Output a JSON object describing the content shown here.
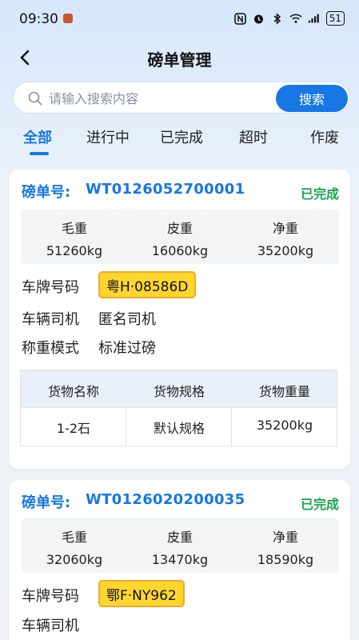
{
  "status_bar": {
    "time": "09:30",
    "battery": "51",
    "icons": [
      "nfc-icon",
      "alarm-icon",
      "bluetooth-icon",
      "wifi-icon",
      "signal-icon",
      "battery-icon"
    ]
  },
  "header": {
    "title": "磅单管理"
  },
  "search": {
    "placeholder": "请输入搜索内容",
    "value": "",
    "button_label": "搜索"
  },
  "tabs": [
    {
      "label": "全部",
      "active": true
    },
    {
      "label": "进行中",
      "active": false
    },
    {
      "label": "已完成",
      "active": false
    },
    {
      "label": "超时",
      "active": false
    },
    {
      "label": "作废",
      "active": false
    }
  ],
  "colors": {
    "accent": "#1677e5",
    "success": "#18a54a",
    "plate_bg": "#ffd62e",
    "plate_border": "#f1a92a"
  },
  "cards": [
    {
      "ticket_label": "磅单号:",
      "ticket_no": "WT0126052700001",
      "status": "已完成",
      "weights": [
        {
          "label": "毛重",
          "value": "51260kg"
        },
        {
          "label": "皮重",
          "value": "16060kg"
        },
        {
          "label": "净重",
          "value": "35200kg"
        }
      ],
      "plate_label": "车牌号码",
      "plate": "粤H·08586D",
      "driver_label": "车辆司机",
      "driver": "匿名司机",
      "mode_label": "称重模式",
      "mode": "标准过磅",
      "goods_headers": [
        "货物名称",
        "货物规格",
        "货物重量"
      ],
      "goods_rows": [
        [
          "1-2石",
          "默认规格",
          "35200kg"
        ]
      ]
    },
    {
      "ticket_label": "磅单号:",
      "ticket_no": "WT0126020200035",
      "status": "已完成",
      "weights": [
        {
          "label": "毛重",
          "value": "32060kg"
        },
        {
          "label": "皮重",
          "value": "13470kg"
        },
        {
          "label": "净重",
          "value": "18590kg"
        }
      ],
      "plate_label": "车牌号码",
      "plate": "鄂F·NY962",
      "driver_label": "车辆司机"
    }
  ]
}
